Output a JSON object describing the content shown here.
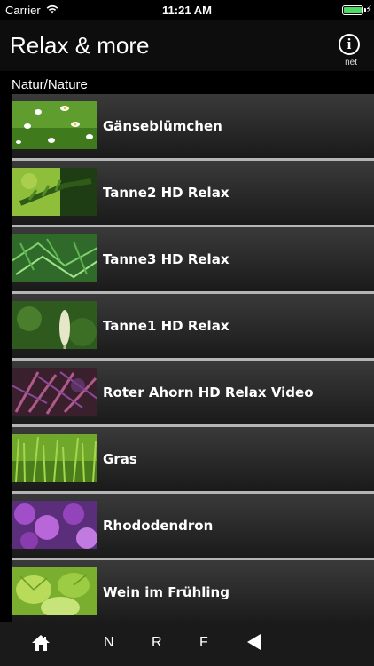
{
  "status": {
    "carrier": "Carrier",
    "time": "11:21 AM",
    "battery_level": 1.0
  },
  "header": {
    "title": "Relax & more",
    "info_caption": "net"
  },
  "section": {
    "title": "Natur/Nature"
  },
  "items": [
    {
      "label": "Gänseblümchen",
      "thumb": "daisies"
    },
    {
      "label": "Tanne2 HD Relax",
      "thumb": "fir-branch"
    },
    {
      "label": "Tanne3 HD Relax",
      "thumb": "fir-needles"
    },
    {
      "label": "Tanne1 HD Relax",
      "thumb": "fir-bud"
    },
    {
      "label": "Roter Ahorn HD Relax Video",
      "thumb": "red-maple"
    },
    {
      "label": "Gras",
      "thumb": "grass"
    },
    {
      "label": "Rhododendron",
      "thumb": "rhododendron"
    },
    {
      "label": "Wein im Frühling",
      "thumb": "vine-leaves"
    }
  ],
  "tabs": {
    "n": "N",
    "r": "R",
    "f": "F"
  },
  "colors": {
    "battery": "#4cd964",
    "separator": "#b5b5b5"
  }
}
